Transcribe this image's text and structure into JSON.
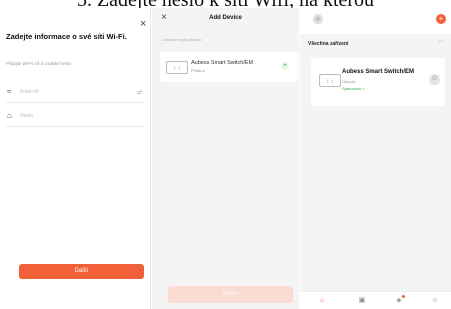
{
  "caption": "5. Zadejte heslo k síti Wifi, na kterou",
  "wifi_panel": {
    "close_icon": "×",
    "title": "Zadejte informace o své síti Wi-Fi.",
    "subtitle": "Připojte Wi-Fi síť a zadejte heslo",
    "network_name": "Krtek-síť",
    "password_placeholder": "Heslo",
    "next_button": "Další"
  },
  "add_device_panel": {
    "close_icon": "×",
    "title": "Add Device",
    "hint": "1 zařízení bylo přidáno",
    "device_name": "Aubess Smart Switch/EM",
    "device_status": "Přidáno",
    "plus_icon": "+",
    "done_button": "Hotovo"
  },
  "home_panel": {
    "avatar_icon": "◎",
    "add_icon": "+",
    "section_heading": "Všechna zařízení",
    "more_icon": "···",
    "device_name": "Aubess Smart Switch/EM",
    "device_room": "Obývák",
    "device_link": "Spárováno >",
    "power_icon": "⏻",
    "tabs": [
      {
        "name": "home",
        "icon": "⌂",
        "active": true
      },
      {
        "name": "scene",
        "icon": "▣",
        "active": false
      },
      {
        "name": "smart",
        "icon": "◈",
        "active": false
      },
      {
        "name": "me",
        "icon": "☺",
        "active": false
      }
    ]
  },
  "colors": {
    "accent": "#f2603a",
    "success": "#2eaa4a"
  }
}
